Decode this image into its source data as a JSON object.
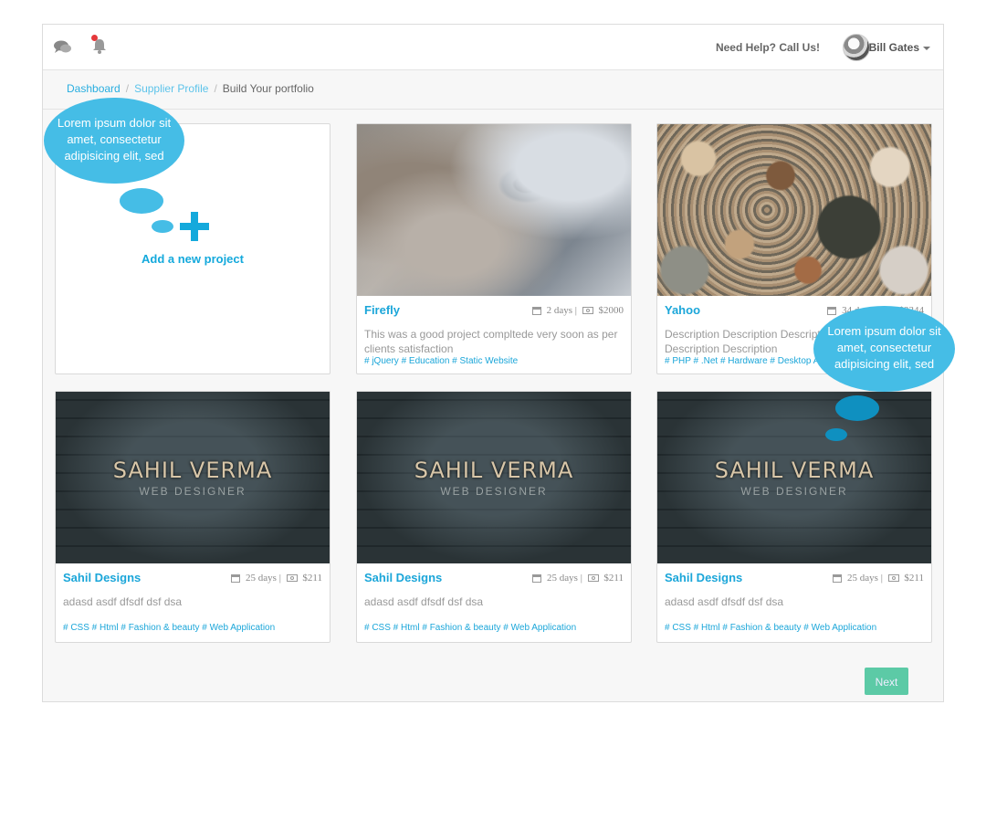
{
  "topbar": {
    "help_text": "Need Help? Call Us!",
    "user_name": "Bill Gates"
  },
  "breadcrumb": {
    "items": [
      "Dashboard",
      "Supplier Profile"
    ],
    "current": "Build Your portfolio"
  },
  "add_project": {
    "label": "Add a new project"
  },
  "bubbles": {
    "top_left": "Lorem ipsum dolor sit amet, consectetur adipisicing elit, sed",
    "right": "Lorem ipsum dolor sit amet, consectetur adipisicing elit, sed"
  },
  "projects": [
    {
      "title": "Firefly",
      "days": "2",
      "days_unit": "days",
      "price": "$2000",
      "description": "This was a good project compltede very soon as per clients satisfaction",
      "tags": "# jQuery  # Education  # Static Website"
    },
    {
      "title": "Yahoo",
      "days": "34",
      "days_unit": "days",
      "price": "$3344",
      "description": "Description Description Description Description Description Description",
      "tags": "# PHP  # .Net  # Hardware  # Desktop Application"
    },
    {
      "title": "Sahil Designs",
      "days": "25",
      "days_unit": "days",
      "price": "$211",
      "description": "adasd asdf dfsdf dsf dsa",
      "tags": "# CSS  # Html  # Fashion & beauty  # Web Application",
      "image_text": "SAHIL VERMA",
      "image_subtext": "WEB DESIGNER"
    },
    {
      "title": "Sahil Designs",
      "days": "25",
      "days_unit": "days",
      "price": "$211",
      "description": "adasd asdf dfsdf dsf dsa",
      "tags": "# CSS  # Html  # Fashion & beauty  # Web Application",
      "image_text": "SAHIL VERMA",
      "image_subtext": "WEB DESIGNER"
    },
    {
      "title": "Sahil Designs",
      "days": "25",
      "days_unit": "days",
      "price": "$211",
      "description": "adasd asdf dfsdf dsf dsa",
      "tags": "# CSS  # Html  # Fashion & beauty  # Web Application",
      "image_text": "SAHIL VERMA",
      "image_subtext": "WEB DESIGNER"
    }
  ],
  "pagination": {
    "next_label": "Next"
  },
  "colors": {
    "accent": "#1ba6d9",
    "bubble": "#45bde6",
    "next_button": "#5ccaa6"
  }
}
